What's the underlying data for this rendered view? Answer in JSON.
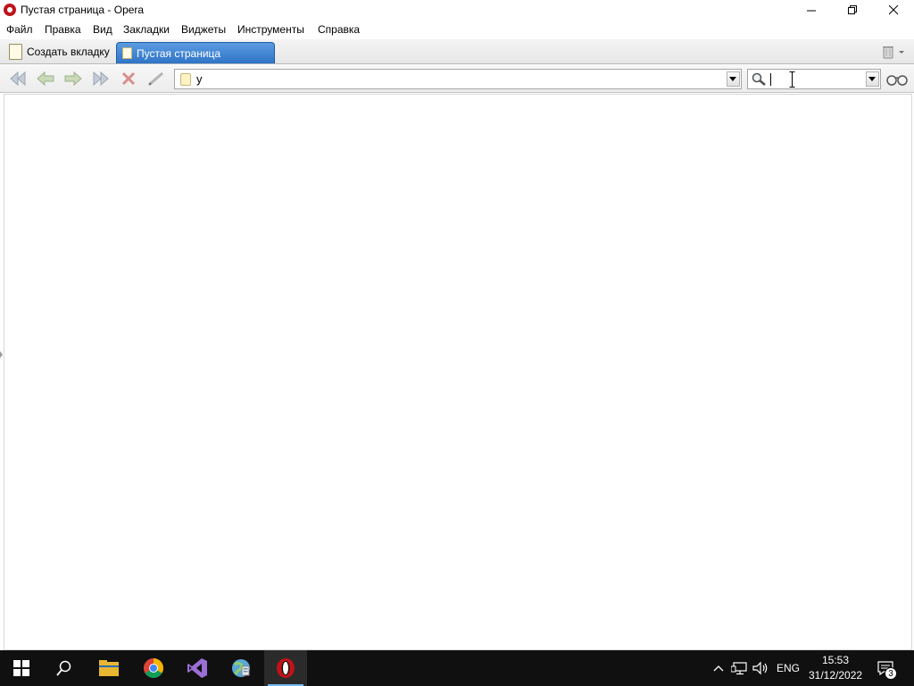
{
  "window": {
    "title": "Пустая страница - Opera",
    "controls": {
      "minimize": "minimize-icon",
      "restore": "restore-icon",
      "close": "close-icon"
    }
  },
  "menu": [
    "Файл",
    "Правка",
    "Вид",
    "Закладки",
    "Виджеты",
    "Инструменты",
    "Справка"
  ],
  "tabs": {
    "new_tab_label": "Создать вкладку",
    "active_tab_label": "Пустая страница"
  },
  "toolbar": {
    "buttons": [
      "rewind-icon",
      "back-icon",
      "forward-icon",
      "fast-forward-icon",
      "stop-icon",
      "edit-icon"
    ],
    "address_value": "у",
    "search_value": "",
    "search_icon": "magnifier-icon",
    "extra_icon": "glasses-icon"
  },
  "taskbar": {
    "apps": [
      "start-icon",
      "search-icon",
      "file-explorer-icon",
      "chrome-icon",
      "visual-studio-icon",
      "globe-app-icon",
      "opera-icon"
    ],
    "active_app": "opera-icon",
    "language": "ENG",
    "time": "15:53",
    "date": "31/12/2022",
    "notification_count": "3"
  },
  "colors": {
    "active_tab": "#2f74c7",
    "taskbar_bg": "#101010",
    "taskbar_accent": "#76b9ed",
    "opera_red": "#c0121a"
  }
}
